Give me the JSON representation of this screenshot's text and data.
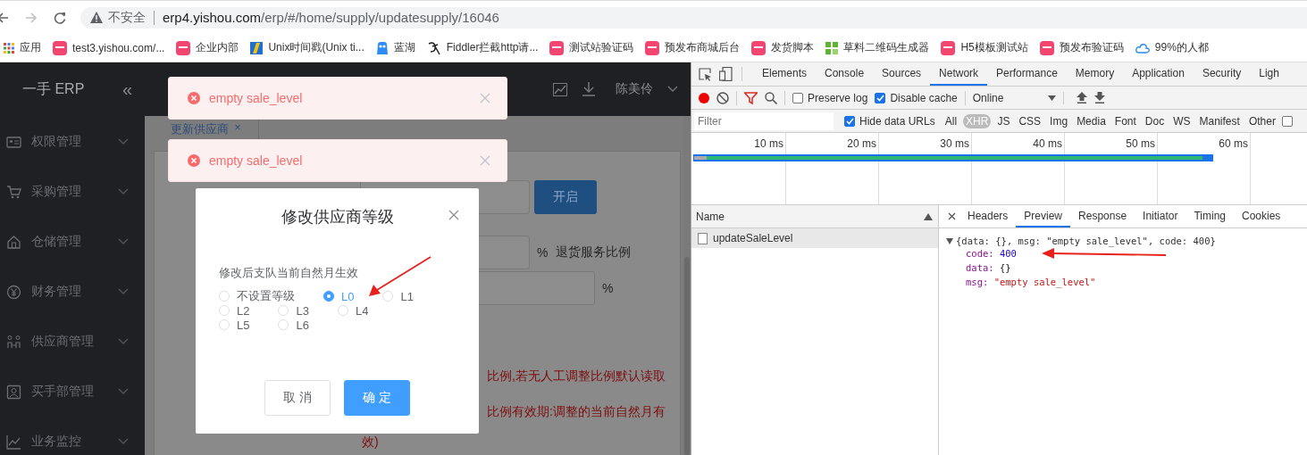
{
  "browser": {
    "security_label": "不安全",
    "url_host": "erp4.yishou.com",
    "url_path": "/erp/#/home/supply/updatesupply/16046"
  },
  "bookmarks": [
    {
      "label": "应用",
      "kind": "apps"
    },
    {
      "label": "test3.yishou.com/...",
      "kind": "yishou"
    },
    {
      "label": "企业内部",
      "kind": "yishou"
    },
    {
      "label": "Unix时间戳(Unix ti...",
      "kind": "unix"
    },
    {
      "label": "蓝湖",
      "kind": "lanhu"
    },
    {
      "label": "Fiddler拦截http请...",
      "kind": "fiddler"
    },
    {
      "label": "测试站验证码",
      "kind": "yishou"
    },
    {
      "label": "预发布商城后台",
      "kind": "yishou"
    },
    {
      "label": "发货脚本",
      "kind": "yishou"
    },
    {
      "label": "草料二维码生成器",
      "kind": "qr"
    },
    {
      "label": "H5模板测试站",
      "kind": "yishou"
    },
    {
      "label": "预发布验证码",
      "kind": "yishou"
    },
    {
      "label": "99%的人都",
      "kind": "cloud"
    }
  ],
  "app": {
    "brand": "一手 ERP",
    "collapse": "«",
    "user": "陈美伶",
    "menu": [
      {
        "label": "权限管理"
      },
      {
        "label": "采购管理"
      },
      {
        "label": "仓储管理"
      },
      {
        "label": "财务管理"
      },
      {
        "label": "供应商管理"
      },
      {
        "label": "买手部管理"
      },
      {
        "label": "业务监控"
      }
    ],
    "tab": {
      "label": "更新供应商",
      "close": "×"
    },
    "form": {
      "button": "开启",
      "percent_1": "%",
      "return_label": "退货服务比例",
      "percent_2": "%",
      "notes": [
        "比例,若无人工调整比例默认读取",
        "比例有效期:调整的当前自然月有",
        "效)"
      ]
    },
    "toasts": [
      {
        "message": "empty sale_level"
      },
      {
        "message": "empty sale_level"
      }
    ],
    "modal": {
      "title": "修改供应商等级",
      "hint": "修改后支队当前自然月生效",
      "options": [
        {
          "label": "不设置等级",
          "selected": false
        },
        {
          "label": "L0",
          "selected": true
        },
        {
          "label": "L1",
          "selected": false
        },
        {
          "label": "L2",
          "selected": false
        },
        {
          "label": "L3",
          "selected": false
        },
        {
          "label": "L4",
          "selected": false
        },
        {
          "label": "L5",
          "selected": false
        },
        {
          "label": "L6",
          "selected": false
        }
      ],
      "buttons": [
        {
          "label": "取 消",
          "kind": "default"
        },
        {
          "label": "确 定",
          "kind": "primary"
        }
      ]
    }
  },
  "devtools": {
    "tabs": [
      {
        "label": "Elements",
        "selected": false
      },
      {
        "label": "Console",
        "selected": false
      },
      {
        "label": "Sources",
        "selected": false
      },
      {
        "label": "Network",
        "selected": true
      },
      {
        "label": "Performance",
        "selected": false
      },
      {
        "label": "Memory",
        "selected": false
      },
      {
        "label": "Application",
        "selected": false
      },
      {
        "label": "Security",
        "selected": false
      },
      {
        "label": "Ligh",
        "selected": false
      }
    ],
    "toolbar": {
      "recording": true,
      "preserve_log": {
        "label": "Preserve log",
        "checked": false
      },
      "disable_cache": {
        "label": "Disable cache",
        "checked": true
      },
      "throttle": "Online"
    },
    "filter": {
      "placeholder": "Filter",
      "hide_data_urls": {
        "label": "Hide data URLs",
        "checked": true
      },
      "extra_checked": false,
      "types": [
        {
          "label": "All",
          "selected": false
        },
        {
          "label": "XHR",
          "selected": true
        },
        {
          "label": "JS",
          "selected": false
        },
        {
          "label": "CSS",
          "selected": false
        },
        {
          "label": "Img",
          "selected": false
        },
        {
          "label": "Media",
          "selected": false
        },
        {
          "label": "Font",
          "selected": false
        },
        {
          "label": "Doc",
          "selected": false
        },
        {
          "label": "WS",
          "selected": false
        },
        {
          "label": "Manifest",
          "selected": false
        },
        {
          "label": "Other",
          "selected": false
        }
      ]
    },
    "overview": {
      "ticks": [
        "10 ms",
        "20 ms",
        "30 ms",
        "40 ms",
        "50 ms",
        "60 ms"
      ]
    },
    "requests": {
      "column": "Name",
      "rows": [
        {
          "name": "updateSaleLevel",
          "selected": true
        }
      ]
    },
    "detail": {
      "tabs": [
        {
          "label": "Headers",
          "selected": false
        },
        {
          "label": "Preview",
          "selected": true
        },
        {
          "label": "Response",
          "selected": false
        },
        {
          "label": "Initiator",
          "selected": false
        },
        {
          "label": "Timing",
          "selected": false
        },
        {
          "label": "Cookies",
          "selected": false
        }
      ],
      "preview": {
        "summary": "{data: {}, msg: \"empty sale_level\", code: 400}",
        "expanded": true,
        "properties": [
          {
            "key": "code:",
            "value": "400",
            "kind": "number"
          },
          {
            "key": "data:",
            "value": "{}",
            "kind": "object"
          },
          {
            "key": "msg:",
            "value": "\"empty sale_level\"",
            "kind": "string"
          }
        ]
      }
    }
  }
}
